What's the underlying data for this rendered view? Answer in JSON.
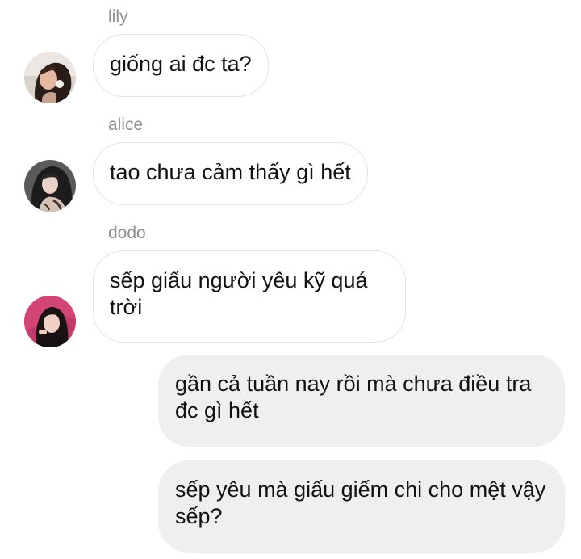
{
  "messages": [
    {
      "sender": "lily",
      "text": "giống ai đc ta?",
      "direction": "incoming",
      "avatar": "avatar-lily"
    },
    {
      "sender": "alice",
      "text": "tao chưa cảm thấy gì hết",
      "direction": "incoming",
      "avatar": "avatar-alice"
    },
    {
      "sender": "dodo",
      "text": "sếp giấu người yêu kỹ quá trời",
      "direction": "incoming",
      "avatar": "avatar-dodo"
    },
    {
      "text": "gần cả tuần nay rồi mà chưa điều tra đc gì hết",
      "direction": "outgoing"
    },
    {
      "text": "sếp yêu mà giấu giếm chi cho mệt vậy sếp?",
      "direction": "outgoing"
    }
  ],
  "colors": {
    "incoming_bubble": "#ffffff",
    "incoming_border": "#e3e3e3",
    "outgoing_bubble": "#efefef",
    "sender_name": "#8e8e8e",
    "text": "#121212"
  }
}
